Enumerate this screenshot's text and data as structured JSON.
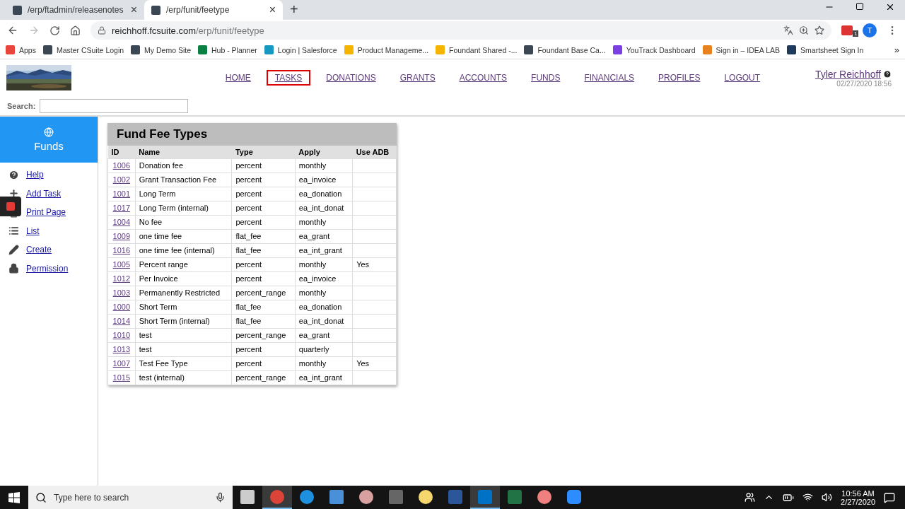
{
  "browser": {
    "tabs": [
      {
        "title": "/erp/ftadmin/releasenotes",
        "selected": false,
        "close": "×"
      },
      {
        "title": "/erp/funit/feetype",
        "selected": true,
        "close": "×"
      }
    ],
    "new_tab": "+",
    "address": {
      "host": "reichhoff.fcsuite.com",
      "path": "/erp/funit/feetype"
    },
    "extension_badge": "1",
    "avatar": "T",
    "bookmarks": [
      {
        "label": "Apps",
        "kind": "apps"
      },
      {
        "label": "Master CSuite Login",
        "kind": "site"
      },
      {
        "label": "My Demo Site",
        "kind": "site"
      },
      {
        "label": "Hub - Planner",
        "kind": "planner"
      },
      {
        "label": "Login | Salesforce",
        "kind": "cloud"
      },
      {
        "label": "Product Manageme...",
        "kind": "drive"
      },
      {
        "label": "Foundant Shared -...",
        "kind": "drive"
      },
      {
        "label": "Foundant Base Ca...",
        "kind": "site"
      },
      {
        "label": "YouTrack Dashboard",
        "kind": "youtrack"
      },
      {
        "label": "Sign in – IDEA LAB",
        "kind": "idea"
      },
      {
        "label": "Smartsheet Sign In",
        "kind": "smartsheet"
      }
    ],
    "more_bookmarks": "»"
  },
  "header": {
    "nav": [
      {
        "label": "HOME",
        "selected": false
      },
      {
        "label": "TASKS",
        "selected": true
      },
      {
        "label": "DONATIONS",
        "selected": false
      },
      {
        "label": "GRANTS",
        "selected": false
      },
      {
        "label": "ACCOUNTS",
        "selected": false
      },
      {
        "label": "FUNDS",
        "selected": false
      },
      {
        "label": "FINANCIALS",
        "selected": false
      },
      {
        "label": "PROFILES",
        "selected": false
      },
      {
        "label": "LOGOUT",
        "selected": false
      }
    ],
    "user": "Tyler Reichhoff",
    "timestamp": "02/27/2020 18:56",
    "search": {
      "label": "Search:"
    }
  },
  "sidebar": {
    "title": "Funds",
    "items": [
      {
        "label": "Help",
        "kind": "help"
      },
      {
        "label": "Add Task",
        "kind": "add"
      },
      {
        "label": "Print Page",
        "kind": "print"
      },
      {
        "label": "List",
        "kind": "list"
      },
      {
        "label": "Create",
        "kind": "create"
      },
      {
        "label": "Permission",
        "kind": "permission"
      }
    ]
  },
  "table": {
    "title": "Fund Fee Types",
    "columns": [
      "ID",
      "Name",
      "Type",
      "Apply",
      "Use ADB"
    ],
    "rows": [
      [
        "1006",
        "Donation fee",
        "percent",
        "monthly",
        ""
      ],
      [
        "1002",
        "Grant Transaction Fee",
        "percent",
        "ea_invoice",
        ""
      ],
      [
        "1001",
        "Long Term",
        "percent",
        "ea_donation",
        ""
      ],
      [
        "1017",
        "Long Term (internal)",
        "percent",
        "ea_int_donat",
        ""
      ],
      [
        "1004",
        "No fee",
        "percent",
        "monthly",
        ""
      ],
      [
        "1009",
        "one time fee",
        "flat_fee",
        "ea_grant",
        ""
      ],
      [
        "1016",
        "one time fee (internal)",
        "flat_fee",
        "ea_int_grant",
        ""
      ],
      [
        "1005",
        "Percent range",
        "percent",
        "monthly",
        "Yes"
      ],
      [
        "1012",
        "Per Invoice",
        "percent",
        "ea_invoice",
        ""
      ],
      [
        "1003",
        "Permanently Restricted",
        "percent_range",
        "monthly",
        ""
      ],
      [
        "1000",
        "Short Term",
        "flat_fee",
        "ea_donation",
        ""
      ],
      [
        "1014",
        "Short Term (internal)",
        "flat_fee",
        "ea_int_donat",
        ""
      ],
      [
        "1010",
        "test",
        "percent_range",
        "ea_grant",
        ""
      ],
      [
        "1013",
        "test",
        "percent",
        "quarterly",
        ""
      ],
      [
        "1007",
        "Test Fee Type",
        "percent",
        "monthly",
        "Yes"
      ],
      [
        "1015",
        "test (internal)",
        "percent_range",
        "ea_int_grant",
        ""
      ]
    ]
  },
  "taskbar": {
    "search_placeholder": "Type here to search",
    "apps": [
      {
        "kind": "taskview",
        "active": false
      },
      {
        "kind": "chrome",
        "active": true
      },
      {
        "kind": "edge",
        "active": false
      },
      {
        "kind": "network",
        "active": false
      },
      {
        "kind": "snip",
        "active": false
      },
      {
        "kind": "calculator",
        "active": false
      },
      {
        "kind": "sticky",
        "active": false
      },
      {
        "kind": "word",
        "active": false
      },
      {
        "kind": "outlook",
        "active": true
      },
      {
        "kind": "excel",
        "active": false
      },
      {
        "kind": "flower",
        "active": false
      },
      {
        "kind": "zoom",
        "active": false
      }
    ],
    "time": "10:56 AM",
    "date": "2/27/2020"
  }
}
